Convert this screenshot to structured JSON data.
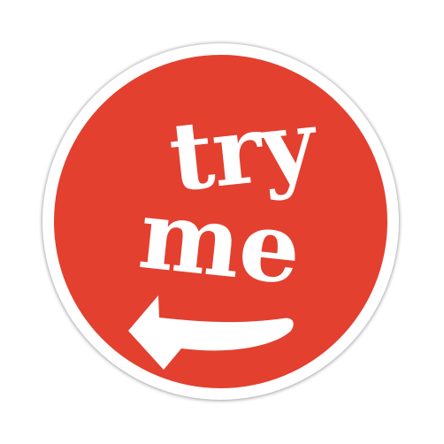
{
  "sticker": {
    "line1": "try",
    "line2": "me",
    "icon": "arrow-left-icon",
    "colors": {
      "fill": "#e3402f",
      "text": "#ffffff",
      "border": "#ffffff"
    }
  }
}
